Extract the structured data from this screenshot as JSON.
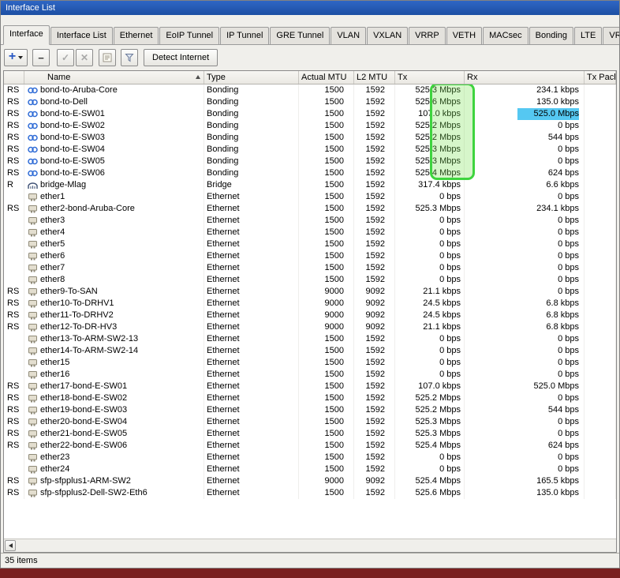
{
  "window": {
    "title": "Interface List"
  },
  "tabs": [
    "Interface",
    "Interface List",
    "Ethernet",
    "EoIP Tunnel",
    "IP Tunnel",
    "GRE Tunnel",
    "VLAN",
    "VXLAN",
    "VRRP",
    "VETH",
    "MACsec",
    "Bonding",
    "LTE",
    "VRF"
  ],
  "active_tab": "Interface",
  "toolbar": {
    "icons": [
      "add-icon",
      "remove-icon",
      "enable-icon",
      "disable-icon",
      "comment-icon",
      "filter-icon"
    ],
    "detect_internet": "Detect Internet"
  },
  "table": {
    "columns": [
      "Name",
      "Type",
      "Actual MTU",
      "L2 MTU",
      "Tx",
      "Rx",
      "Tx Packet"
    ],
    "sorted_by": "Name",
    "rows": [
      {
        "flags": "RS",
        "icon": "bonding",
        "name": "bond-to-Aruba-Core",
        "type": "Bonding",
        "actual_mtu": "1500",
        "l2_mtu": "1592",
        "tx": "525.3 Mbps",
        "rx": "234.1 kbps",
        "tx_packet": ""
      },
      {
        "flags": "RS",
        "icon": "bonding",
        "name": "bond-to-Dell",
        "type": "Bonding",
        "actual_mtu": "1500",
        "l2_mtu": "1592",
        "tx": "525.6 Mbps",
        "rx": "135.0 kbps",
        "tx_packet": ""
      },
      {
        "flags": "RS",
        "icon": "bonding",
        "name": "bond-to-E-SW01",
        "type": "Bonding",
        "actual_mtu": "1500",
        "l2_mtu": "1592",
        "tx": "107.0 kbps",
        "rx": "525.0 Mbps",
        "tx_packet": "",
        "rx_highlight": true
      },
      {
        "flags": "RS",
        "icon": "bonding",
        "name": "bond-to-E-SW02",
        "type": "Bonding",
        "actual_mtu": "1500",
        "l2_mtu": "1592",
        "tx": "525.2 Mbps",
        "rx": "0 bps",
        "tx_packet": ""
      },
      {
        "flags": "RS",
        "icon": "bonding",
        "name": "bond-to-E-SW03",
        "type": "Bonding",
        "actual_mtu": "1500",
        "l2_mtu": "1592",
        "tx": "525.2 Mbps",
        "rx": "544 bps",
        "tx_packet": ""
      },
      {
        "flags": "RS",
        "icon": "bonding",
        "name": "bond-to-E-SW04",
        "type": "Bonding",
        "actual_mtu": "1500",
        "l2_mtu": "1592",
        "tx": "525.3 Mbps",
        "rx": "0 bps",
        "tx_packet": ""
      },
      {
        "flags": "RS",
        "icon": "bonding",
        "name": "bond-to-E-SW05",
        "type": "Bonding",
        "actual_mtu": "1500",
        "l2_mtu": "1592",
        "tx": "525.3 Mbps",
        "rx": "0 bps",
        "tx_packet": ""
      },
      {
        "flags": "RS",
        "icon": "bonding",
        "name": "bond-to-E-SW06",
        "type": "Bonding",
        "actual_mtu": "1500",
        "l2_mtu": "1592",
        "tx": "525.4 Mbps",
        "rx": "624 bps",
        "tx_packet": ""
      },
      {
        "flags": "R",
        "icon": "bridge",
        "name": "bridge-Mlag",
        "type": "Bridge",
        "actual_mtu": "1500",
        "l2_mtu": "1592",
        "tx": "317.4 kbps",
        "rx": "6.6 kbps",
        "tx_packet": ""
      },
      {
        "flags": "",
        "icon": "ethernet",
        "name": "ether1",
        "type": "Ethernet",
        "actual_mtu": "1500",
        "l2_mtu": "1592",
        "tx": "0 bps",
        "rx": "0 bps",
        "tx_packet": ""
      },
      {
        "flags": "RS",
        "icon": "ethernet",
        "name": "ether2-bond-Aruba-Core",
        "type": "Ethernet",
        "actual_mtu": "1500",
        "l2_mtu": "1592",
        "tx": "525.3 Mbps",
        "rx": "234.1 kbps",
        "tx_packet": ""
      },
      {
        "flags": "",
        "icon": "ethernet",
        "name": "ether3",
        "type": "Ethernet",
        "actual_mtu": "1500",
        "l2_mtu": "1592",
        "tx": "0 bps",
        "rx": "0 bps",
        "tx_packet": ""
      },
      {
        "flags": "",
        "icon": "ethernet",
        "name": "ether4",
        "type": "Ethernet",
        "actual_mtu": "1500",
        "l2_mtu": "1592",
        "tx": "0 bps",
        "rx": "0 bps",
        "tx_packet": ""
      },
      {
        "flags": "",
        "icon": "ethernet",
        "name": "ether5",
        "type": "Ethernet",
        "actual_mtu": "1500",
        "l2_mtu": "1592",
        "tx": "0 bps",
        "rx": "0 bps",
        "tx_packet": ""
      },
      {
        "flags": "",
        "icon": "ethernet",
        "name": "ether6",
        "type": "Ethernet",
        "actual_mtu": "1500",
        "l2_mtu": "1592",
        "tx": "0 bps",
        "rx": "0 bps",
        "tx_packet": ""
      },
      {
        "flags": "",
        "icon": "ethernet",
        "name": "ether7",
        "type": "Ethernet",
        "actual_mtu": "1500",
        "l2_mtu": "1592",
        "tx": "0 bps",
        "rx": "0 bps",
        "tx_packet": ""
      },
      {
        "flags": "",
        "icon": "ethernet",
        "name": "ether8",
        "type": "Ethernet",
        "actual_mtu": "1500",
        "l2_mtu": "1592",
        "tx": "0 bps",
        "rx": "0 bps",
        "tx_packet": ""
      },
      {
        "flags": "RS",
        "icon": "ethernet",
        "name": "ether9-To-SAN",
        "type": "Ethernet",
        "actual_mtu": "9000",
        "l2_mtu": "9092",
        "tx": "21.1 kbps",
        "rx": "0 bps",
        "tx_packet": ""
      },
      {
        "flags": "RS",
        "icon": "ethernet",
        "name": "ether10-To-DRHV1",
        "type": "Ethernet",
        "actual_mtu": "9000",
        "l2_mtu": "9092",
        "tx": "24.5 kbps",
        "rx": "6.8 kbps",
        "tx_packet": ""
      },
      {
        "flags": "RS",
        "icon": "ethernet",
        "name": "ether11-To-DRHV2",
        "type": "Ethernet",
        "actual_mtu": "9000",
        "l2_mtu": "9092",
        "tx": "24.5 kbps",
        "rx": "6.8 kbps",
        "tx_packet": ""
      },
      {
        "flags": "RS",
        "icon": "ethernet",
        "name": "ether12-To-DR-HV3",
        "type": "Ethernet",
        "actual_mtu": "9000",
        "l2_mtu": "9092",
        "tx": "21.1 kbps",
        "rx": "6.8 kbps",
        "tx_packet": ""
      },
      {
        "flags": "",
        "icon": "ethernet",
        "name": "ether13-To-ARM-SW2-13",
        "type": "Ethernet",
        "actual_mtu": "1500",
        "l2_mtu": "1592",
        "tx": "0 bps",
        "rx": "0 bps",
        "tx_packet": ""
      },
      {
        "flags": "",
        "icon": "ethernet",
        "name": "ether14-To-ARM-SW2-14",
        "type": "Ethernet",
        "actual_mtu": "1500",
        "l2_mtu": "1592",
        "tx": "0 bps",
        "rx": "0 bps",
        "tx_packet": ""
      },
      {
        "flags": "",
        "icon": "ethernet",
        "name": "ether15",
        "type": "Ethernet",
        "actual_mtu": "1500",
        "l2_mtu": "1592",
        "tx": "0 bps",
        "rx": "0 bps",
        "tx_packet": ""
      },
      {
        "flags": "",
        "icon": "ethernet",
        "name": "ether16",
        "type": "Ethernet",
        "actual_mtu": "1500",
        "l2_mtu": "1592",
        "tx": "0 bps",
        "rx": "0 bps",
        "tx_packet": ""
      },
      {
        "flags": "RS",
        "icon": "ethernet",
        "name": "ether17-bond-E-SW01",
        "type": "Ethernet",
        "actual_mtu": "1500",
        "l2_mtu": "1592",
        "tx": "107.0 kbps",
        "rx": "525.0 Mbps",
        "tx_packet": ""
      },
      {
        "flags": "RS",
        "icon": "ethernet",
        "name": "ether18-bond-E-SW02",
        "type": "Ethernet",
        "actual_mtu": "1500",
        "l2_mtu": "1592",
        "tx": "525.2 Mbps",
        "rx": "0 bps",
        "tx_packet": ""
      },
      {
        "flags": "RS",
        "icon": "ethernet",
        "name": "ether19-bond-E-SW03",
        "type": "Ethernet",
        "actual_mtu": "1500",
        "l2_mtu": "1592",
        "tx": "525.2 Mbps",
        "rx": "544 bps",
        "tx_packet": ""
      },
      {
        "flags": "RS",
        "icon": "ethernet",
        "name": "ether20-bond-E-SW04",
        "type": "Ethernet",
        "actual_mtu": "1500",
        "l2_mtu": "1592",
        "tx": "525.3 Mbps",
        "rx": "0 bps",
        "tx_packet": ""
      },
      {
        "flags": "RS",
        "icon": "ethernet",
        "name": "ether21-bond-E-SW05",
        "type": "Ethernet",
        "actual_mtu": "1500",
        "l2_mtu": "1592",
        "tx": "525.3 Mbps",
        "rx": "0 bps",
        "tx_packet": ""
      },
      {
        "flags": "RS",
        "icon": "ethernet",
        "name": "ether22-bond-E-SW06",
        "type": "Ethernet",
        "actual_mtu": "1500",
        "l2_mtu": "1592",
        "tx": "525.4 Mbps",
        "rx": "624 bps",
        "tx_packet": ""
      },
      {
        "flags": "",
        "icon": "ethernet",
        "name": "ether23",
        "type": "Ethernet",
        "actual_mtu": "1500",
        "l2_mtu": "1592",
        "tx": "0 bps",
        "rx": "0 bps",
        "tx_packet": ""
      },
      {
        "flags": "",
        "icon": "ethernet",
        "name": "ether24",
        "type": "Ethernet",
        "actual_mtu": "1500",
        "l2_mtu": "1592",
        "tx": "0 bps",
        "rx": "0 bps",
        "tx_packet": ""
      },
      {
        "flags": "RS",
        "icon": "ethernet",
        "name": "sfp-sfpplus1-ARM-SW2",
        "type": "Ethernet",
        "actual_mtu": "9000",
        "l2_mtu": "9092",
        "tx": "525.4 Mbps",
        "rx": "165.5 kbps",
        "tx_packet": ""
      },
      {
        "flags": "RS",
        "icon": "ethernet",
        "name": "sfp-sfpplus2-Dell-SW2-Eth6",
        "type": "Ethernet",
        "actual_mtu": "1500",
        "l2_mtu": "1592",
        "tx": "525.6 Mbps",
        "rx": "135.0 kbps",
        "tx_packet": ""
      }
    ]
  },
  "annotations": {
    "green_box": {
      "column": "Tx",
      "first_row": "bond-to-Aruba-Core",
      "last_row": "bond-to-E-SW06",
      "color": "#3ed43e",
      "fill": "rgba(120,226,80,0.30)"
    },
    "blue_highlight": {
      "column": "Rx",
      "row": "bond-to-E-SW01",
      "value": "525.0 Mbps",
      "color": "#55c8f2"
    }
  },
  "status_bar": {
    "items_count": "35 items"
  }
}
